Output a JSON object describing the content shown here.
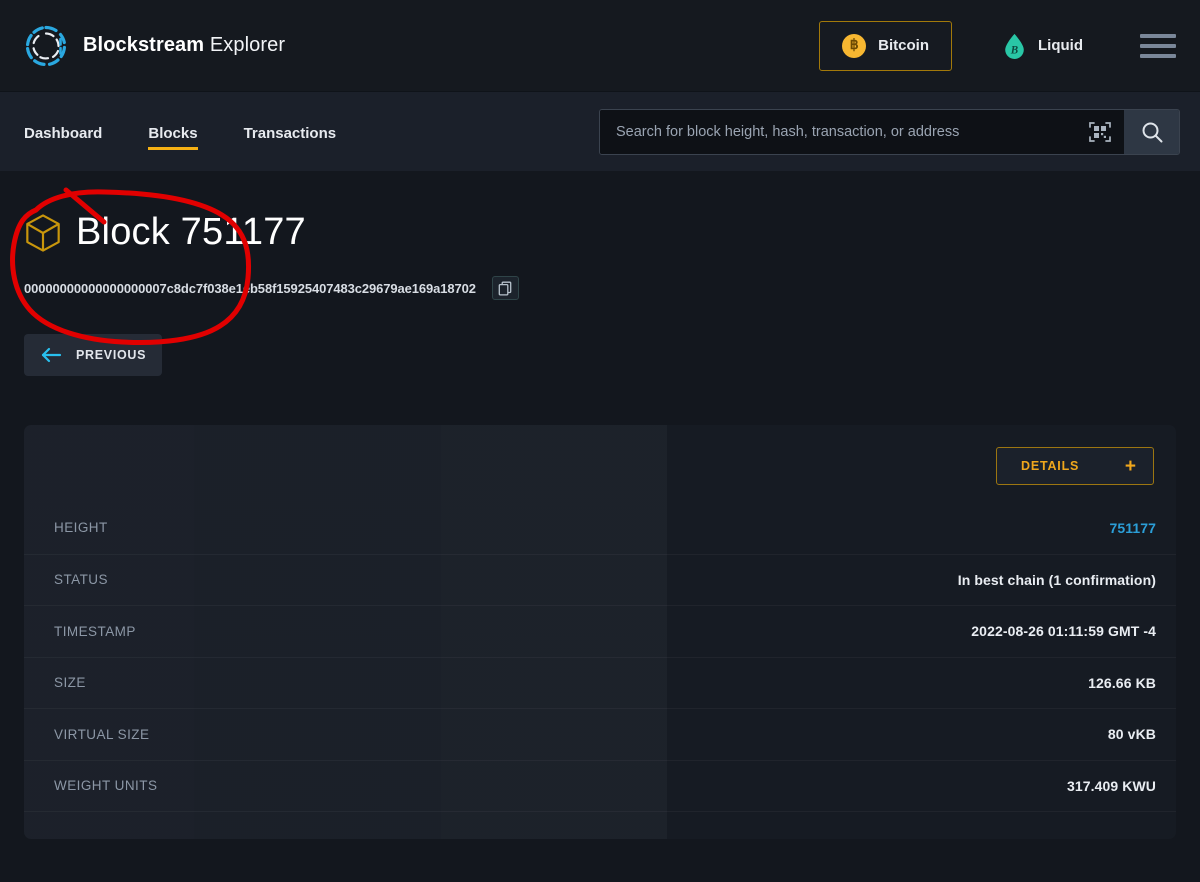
{
  "header": {
    "brand_bold": "Blockstream",
    "brand_light": "Explorer",
    "logo_icon": "blockstream-ring-logo",
    "networks": [
      {
        "label": "Bitcoin",
        "icon": "bitcoin-coin-icon",
        "active": true
      },
      {
        "label": "Liquid",
        "icon": "liquid-droplet-icon",
        "active": false
      }
    ],
    "menu_icon": "hamburger-menu-icon"
  },
  "nav": {
    "links": [
      {
        "label": "Dashboard",
        "active": false
      },
      {
        "label": "Blocks",
        "active": true
      },
      {
        "label": "Transactions",
        "active": false
      }
    ],
    "search": {
      "placeholder": "Search for block height, hash, transaction, or address",
      "value": "",
      "qr_icon": "qr-scan-icon",
      "search_icon": "search-icon"
    }
  },
  "page": {
    "block_icon": "cube-icon",
    "title": "Block 751177",
    "hash": "00000000000000000007c8dc7f038e1eb58f15925407483c29679ae169a18702",
    "copy_icon": "copy-icon",
    "previous_button": {
      "label": "PREVIOUS",
      "icon": "arrow-left-icon"
    }
  },
  "details": {
    "toggle": {
      "label": "DETAILS",
      "expand_icon": "plus-icon"
    },
    "rows": [
      {
        "label": "HEIGHT",
        "value": "751177",
        "is_link": true
      },
      {
        "label": "STATUS",
        "value": "In best chain (1 confirmation)",
        "is_link": false
      },
      {
        "label": "TIMESTAMP",
        "value": "2022-08-26 01:11:59 GMT -4",
        "is_link": false
      },
      {
        "label": "SIZE",
        "value": "126.66 KB",
        "is_link": false
      },
      {
        "label": "VIRTUAL SIZE",
        "value": "80 vKB",
        "is_link": false
      },
      {
        "label": "WEIGHT UNITS",
        "value": "317.409 KWU",
        "is_link": false
      }
    ]
  },
  "annotation": {
    "shape": "hand-drawn-red-ellipse",
    "color": "#e10000",
    "targets": "Block 751177 title and block hash"
  },
  "colors": {
    "page_background": "#13171e",
    "topbar_background": "#15191f",
    "navbar_background": "#1b202a",
    "card_background": "#191e27",
    "accent_gold": "#f5b014",
    "accent_cyan": "#2b9fd8",
    "link_blue": "#2b9fd8",
    "annotation_red": "#e10000"
  }
}
